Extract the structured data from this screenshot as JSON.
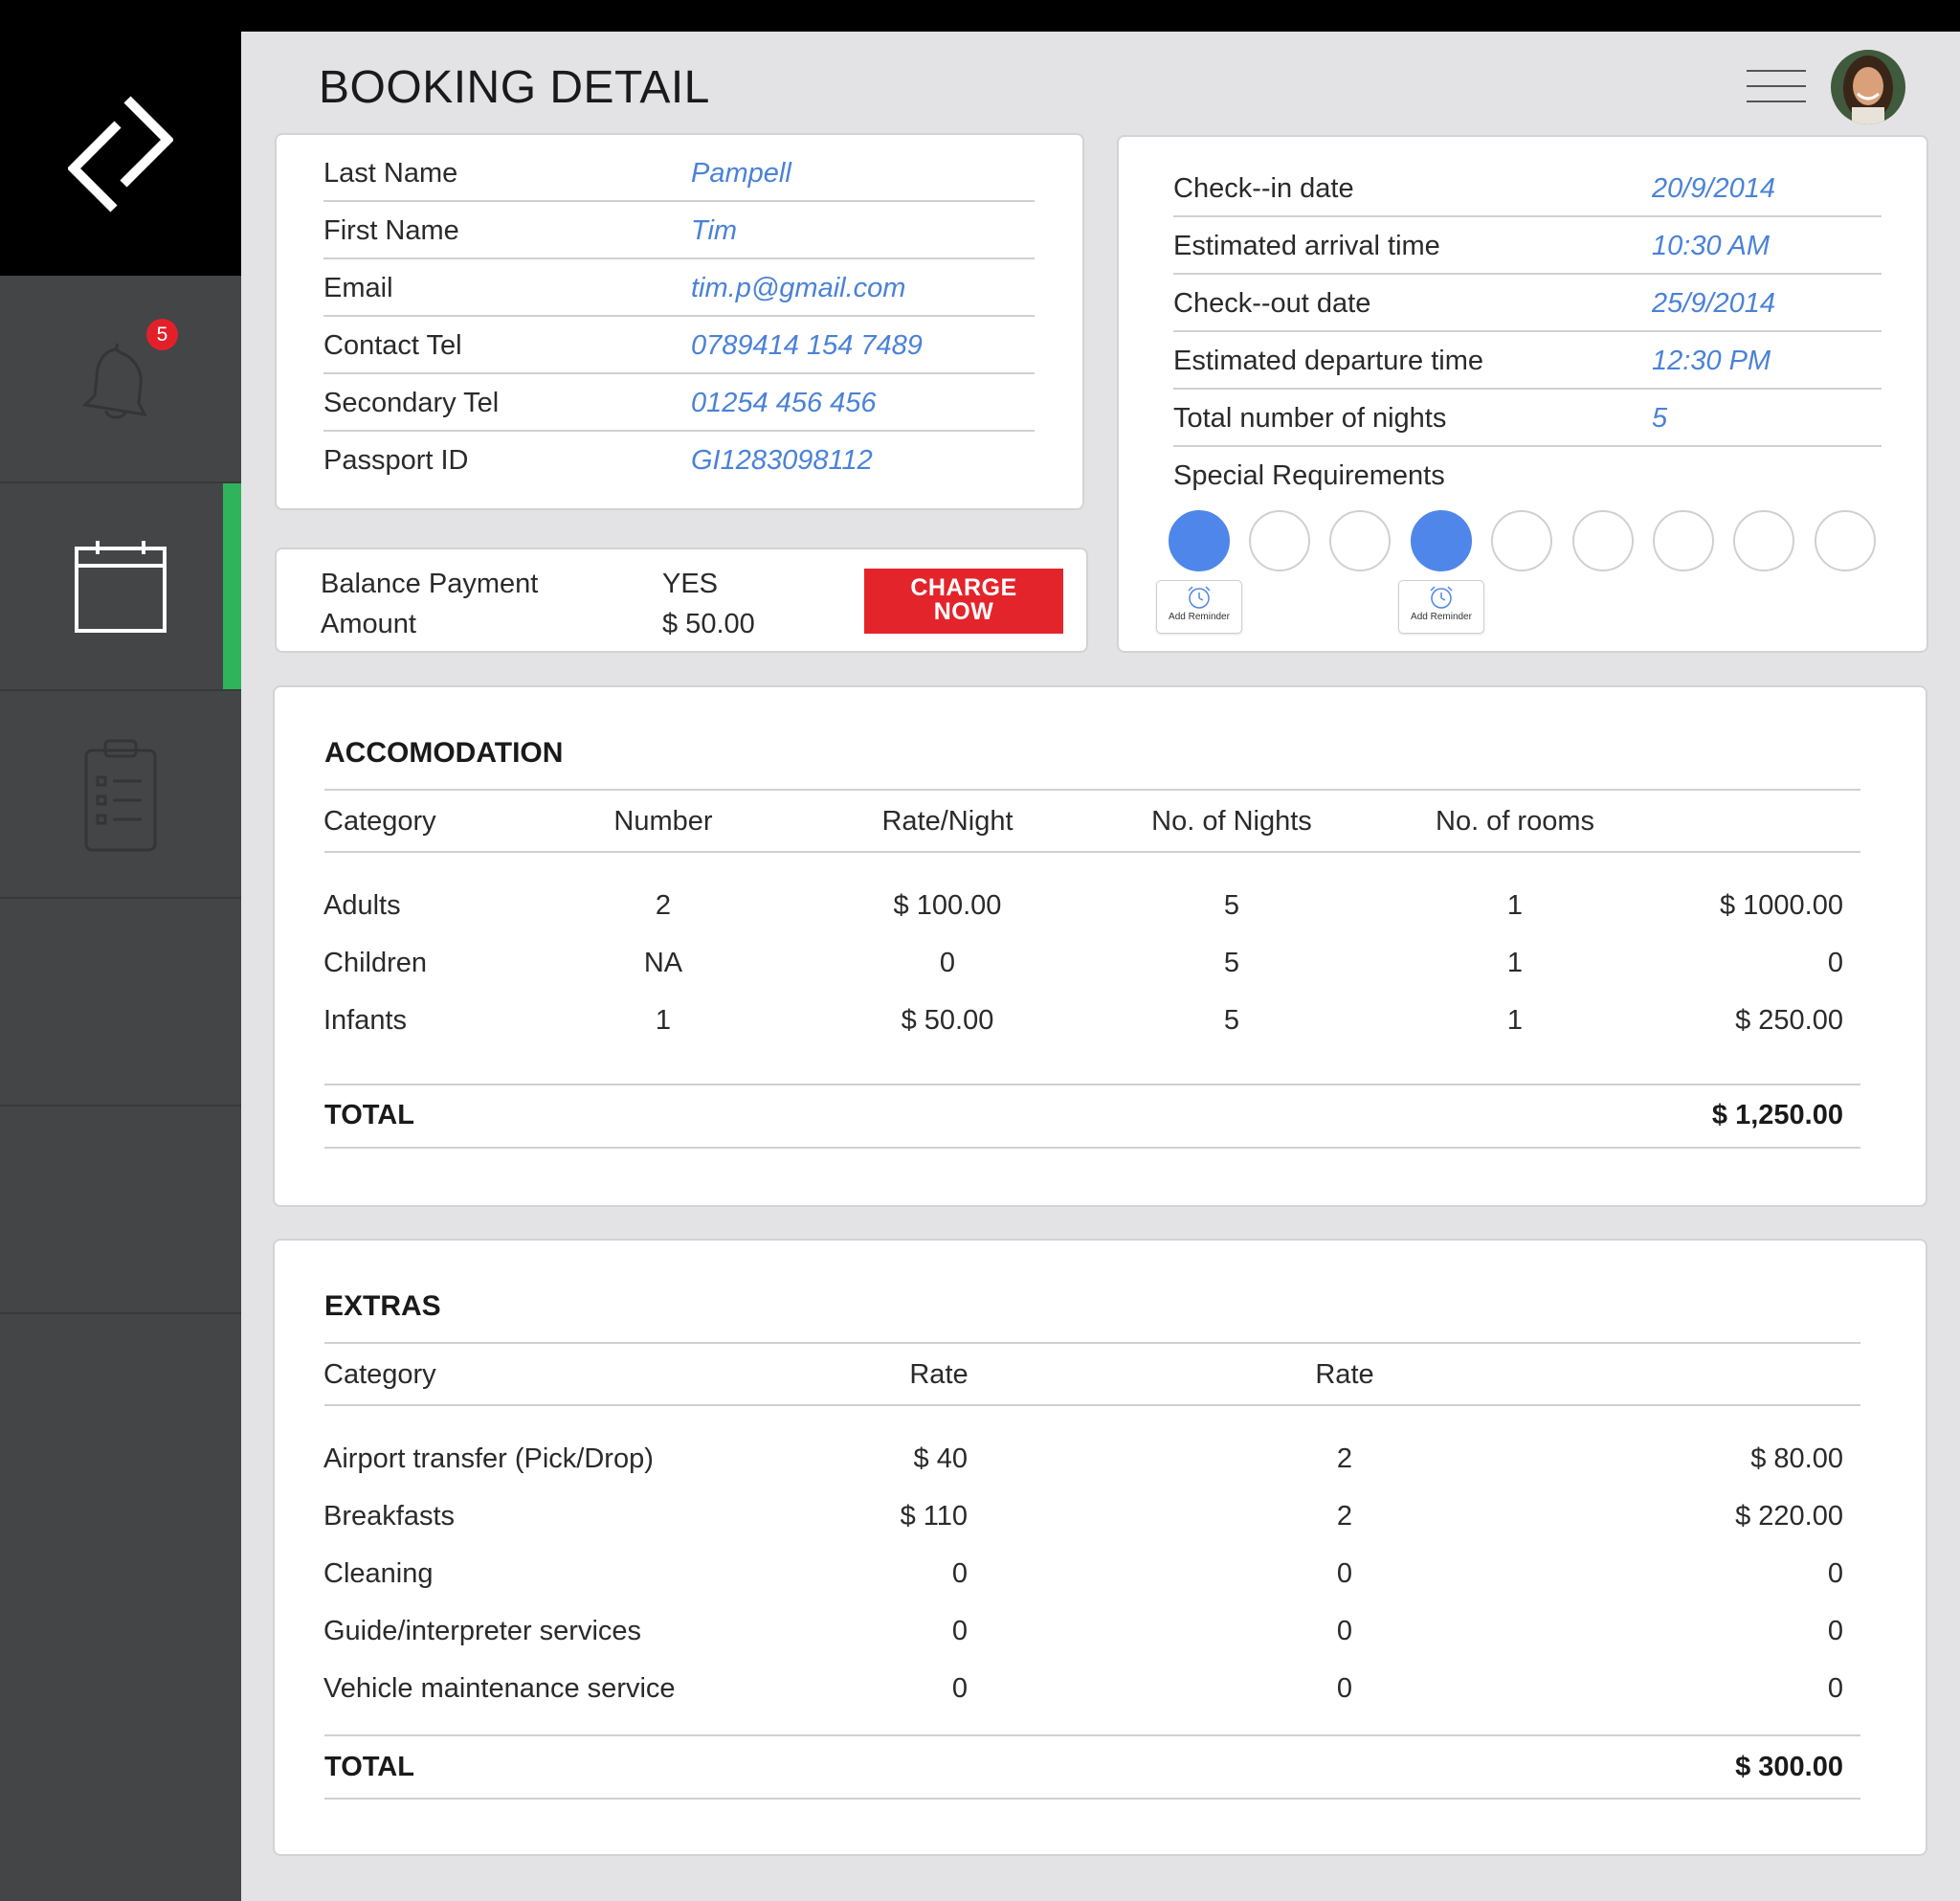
{
  "page": {
    "title": "BOOKING DETAIL"
  },
  "sidebar": {
    "notifications_count": "5"
  },
  "guest": {
    "rows": [
      {
        "label": "Last Name",
        "value": "Pampell"
      },
      {
        "label": "First Name",
        "value": "Tim"
      },
      {
        "label": "Email",
        "value": "tim.p@gmail.com"
      },
      {
        "label": "Contact Tel",
        "value": "0789414 154 7489"
      },
      {
        "label": "Secondary Tel",
        "value": "01254 456 456"
      },
      {
        "label": "Passport ID",
        "value": "GI1283098112"
      }
    ]
  },
  "payment": {
    "balance_label": "Balance Payment",
    "balance_value": "YES",
    "amount_label": "Amount",
    "amount_value": "$ 50.00",
    "charge_label_line1": "CHARGE",
    "charge_label_line2": "NOW"
  },
  "stay": {
    "rows": [
      {
        "label": "Check--in date",
        "value": "20/9/2014"
      },
      {
        "label": "Estimated arrival time",
        "value": "10:30 AM"
      },
      {
        "label": "Check--out date",
        "value": "25/9/2014"
      },
      {
        "label": "Estimated departure time",
        "value": "12:30 PM"
      },
      {
        "label": "Total number of nights",
        "value": "5"
      }
    ],
    "special_label": "Special Requirements",
    "requirements_selected": [
      true,
      false,
      false,
      true,
      false,
      false,
      false,
      false,
      false
    ],
    "reminder_label": "Add Reminder"
  },
  "accommodation": {
    "title": "ACCOMODATION",
    "headers": [
      "Category",
      "Number",
      "Rate/Night",
      "No. of Nights",
      "No. of rooms"
    ],
    "rows": [
      [
        "Adults",
        "2",
        "$ 100.00",
        "5",
        "1",
        "$ 1000.00"
      ],
      [
        "Children",
        "NA",
        "0",
        "5",
        "1",
        "0"
      ],
      [
        "Infants",
        "1",
        "$ 50.00",
        "5",
        "1",
        "$ 250.00"
      ]
    ],
    "total_label": "TOTAL",
    "total_value": "$ 1,250.00"
  },
  "extras": {
    "title": "EXTRAS",
    "headers": [
      "Category",
      "Rate",
      "Rate"
    ],
    "rows": [
      [
        "Airport transfer (Pick/Drop)",
        "$ 40",
        "2",
        "$ 80.00"
      ],
      [
        "Breakfasts",
        "$ 110",
        "2",
        "$ 220.00"
      ],
      [
        "Cleaning",
        "0",
        "0",
        "0"
      ],
      [
        "Guide/interpreter services",
        "0",
        "0",
        "0"
      ],
      [
        "Vehicle maintenance service",
        "0",
        "0",
        "0"
      ]
    ],
    "total_label": "TOTAL",
    "total_value": "$ 300.00"
  }
}
